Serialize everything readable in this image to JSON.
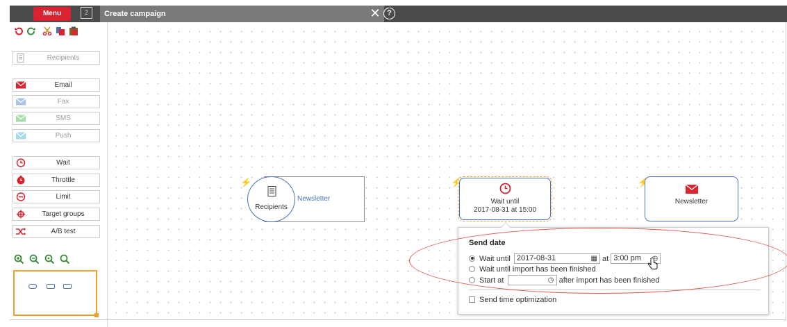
{
  "header": {
    "menu_label": "Menu",
    "window_badge": "2",
    "title": "Create campaign",
    "close_glyph": "✕",
    "help_glyph": "?"
  },
  "toolbar": {
    "icons": [
      "undo-icon",
      "redo-icon",
      "cut-icon",
      "copy-icon",
      "paste-icon"
    ]
  },
  "sidebar": {
    "recipients_label": "Recipients",
    "channels": [
      {
        "label": "Email"
      },
      {
        "label": "Fax"
      },
      {
        "label": "SMS"
      },
      {
        "label": "Push"
      }
    ],
    "controls": [
      {
        "label": "Wait"
      },
      {
        "label": "Throttle"
      },
      {
        "label": "Limit"
      },
      {
        "label": "Target groups"
      },
      {
        "label": "A/B test"
      }
    ]
  },
  "nodes": {
    "recipients": {
      "circle_label": "Recipients",
      "side_label": "Newsletter"
    },
    "wait": {
      "line1": "Wait until",
      "line2": "2017-08-31 at 15:00"
    },
    "newsletter": {
      "label": "Newsletter"
    }
  },
  "send_date": {
    "title": "Send date",
    "option1_label": "Wait until",
    "date_value": "2017-08-31",
    "at_label": "at",
    "time_value": "3:00 pm",
    "option2_label": "Wait until import has been finished",
    "option3_label": "Start at",
    "start_value": "",
    "option3_suffix": "after import has been finished",
    "optimization_label": "Send time optimization"
  },
  "colors": {
    "accent_red": "#d9232e",
    "node_blue": "#4a72b8",
    "selection_orange": "#f0a028",
    "highlight_ellipse": "#e2544a"
  }
}
